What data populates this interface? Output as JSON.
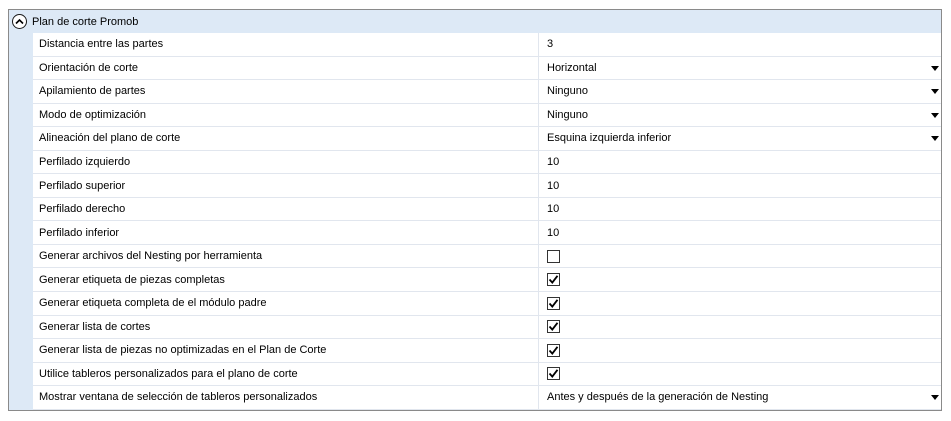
{
  "section": {
    "title": "Plan de corte Promob",
    "collapse_icon": "chevron-up-icon"
  },
  "properties": [
    {
      "label": "Distancia entre las partes",
      "type": "text",
      "value": "3"
    },
    {
      "label": "Orientación de corte",
      "type": "dropdown",
      "value": "Horizontal"
    },
    {
      "label": "Apilamiento de partes",
      "type": "dropdown",
      "value": "Ninguno"
    },
    {
      "label": "Modo de optimización",
      "type": "dropdown",
      "value": "Ninguno"
    },
    {
      "label": "Alineación del plano de corte",
      "type": "dropdown",
      "value": "Esquina izquierda inferior"
    },
    {
      "label": "Perfilado izquierdo",
      "type": "text",
      "value": "10"
    },
    {
      "label": "Perfilado superior",
      "type": "text",
      "value": "10"
    },
    {
      "label": "Perfilado derecho",
      "type": "text",
      "value": "10"
    },
    {
      "label": "Perfilado inferior",
      "type": "text",
      "value": "10"
    },
    {
      "label": "Generar archivos del Nesting por herramienta",
      "type": "checkbox",
      "checked": false
    },
    {
      "label": "Generar etiqueta de piezas completas",
      "type": "checkbox",
      "checked": true
    },
    {
      "label": "Generar etiqueta completa de el módulo padre",
      "type": "checkbox",
      "checked": true
    },
    {
      "label": "Generar lista de cortes",
      "type": "checkbox",
      "checked": true
    },
    {
      "label": "Generar lista de piezas no optimizadas en el Plan de Corte",
      "type": "checkbox",
      "checked": true
    },
    {
      "label": "Utilice tableros personalizados para el plano de corte",
      "type": "checkbox",
      "checked": true
    },
    {
      "label": "Mostrar ventana de selección de tableros personalizados",
      "type": "dropdown",
      "value": "Antes y después de la generación de Nesting"
    }
  ],
  "colors": {
    "header_bg": "#dde9f6",
    "grid_line": "#e1e6ee",
    "border": "#8a8a8a"
  }
}
